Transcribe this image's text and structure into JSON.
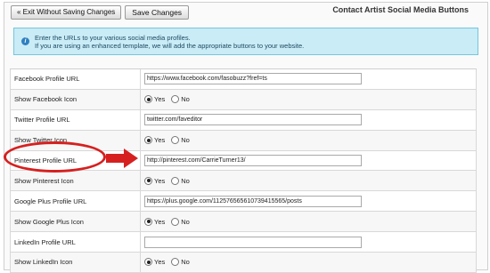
{
  "toolbar": {
    "exit_label": "« Exit Without Saving Changes",
    "save_label": "Save Changes"
  },
  "page": {
    "title": "Contact Artist Social Media Buttons"
  },
  "info": {
    "line1": "Enter the URLs to your various social media profiles.",
    "line2": "If you are using an enhanced template, we will add the appropriate buttons to your website."
  },
  "radio_labels": {
    "yes": "Yes",
    "no": "No"
  },
  "rows": [
    {
      "label": "Facebook Profile URL",
      "value": "https://www.facebook.com/fasobuzz?fref=ts"
    },
    {
      "label": "Show Facebook Icon",
      "selected": "yes"
    },
    {
      "label": "Twitter Profile URL",
      "value": "twitter.com/faveditor"
    },
    {
      "label": "Show Twitter Icon",
      "selected": "yes"
    },
    {
      "label": "Pinterest Profile URL",
      "value": "http://pinterest.com/CarrieTurner13/"
    },
    {
      "label": "Show Pinterest Icon",
      "selected": "yes"
    },
    {
      "label": "Google Plus Profile URL",
      "value": "https://plus.google.com/112576565610739415565/posts"
    },
    {
      "label": "Show Google Plus Icon",
      "selected": "yes"
    },
    {
      "label": "LinkedIn Profile URL",
      "value": ""
    },
    {
      "label": "Show LinkedIn Icon",
      "selected": "yes"
    }
  ],
  "annotation": {
    "color": "#d62020"
  }
}
